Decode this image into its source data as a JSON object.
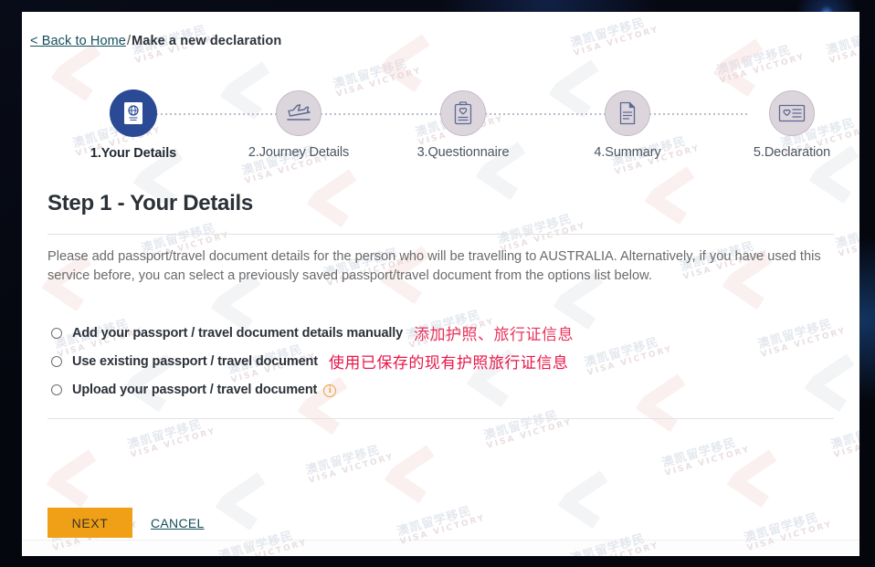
{
  "breadcrumb": {
    "back_link": "< Back to Home",
    "separator": "/",
    "current": "Make a new declaration"
  },
  "stepper": {
    "steps": [
      {
        "label": "1.Your Details",
        "icon": "passport-icon",
        "active": true
      },
      {
        "label": "2.Journey Details",
        "icon": "airplane-icon",
        "active": false
      },
      {
        "label": "3.Questionnaire",
        "icon": "clipboard-icon",
        "active": false
      },
      {
        "label": "4.Summary",
        "icon": "document-icon",
        "active": false
      },
      {
        "label": "5.Declaration",
        "icon": "declaration-card-icon",
        "active": false
      }
    ]
  },
  "main": {
    "title": "Step 1 - Your Details",
    "intro": "Please add passport/travel document details for the person who will be travelling to AUSTRALIA. Alternatively, if you have used this service before, you can select a previously saved passport/travel document from the options list below.",
    "options": [
      {
        "label": "Add your passport / travel document details manually",
        "selected": false,
        "annotation": "添加护照、旅行证信息",
        "info_icon": false
      },
      {
        "label": "Use existing passport / travel document",
        "selected": false,
        "annotation": "使用已保存的现有护照旅行证信息",
        "info_icon": false
      },
      {
        "label": "Upload your passport / travel document",
        "selected": false,
        "annotation": "",
        "info_icon": true,
        "info_icon_glyph": "i"
      }
    ]
  },
  "actions": {
    "next_label": "NEXT",
    "cancel_label": "CANCEL"
  },
  "watermark": {
    "cn_text": "澳凯留学移民",
    "en_text": "VISA VICTORY"
  },
  "colors": {
    "active_step": "#2b4a96",
    "inactive_step": "#ddd5dc",
    "next_button": "#f0a016",
    "link": "#14505c",
    "annotation": "#e8174a",
    "info_icon": "#e8a33d"
  }
}
